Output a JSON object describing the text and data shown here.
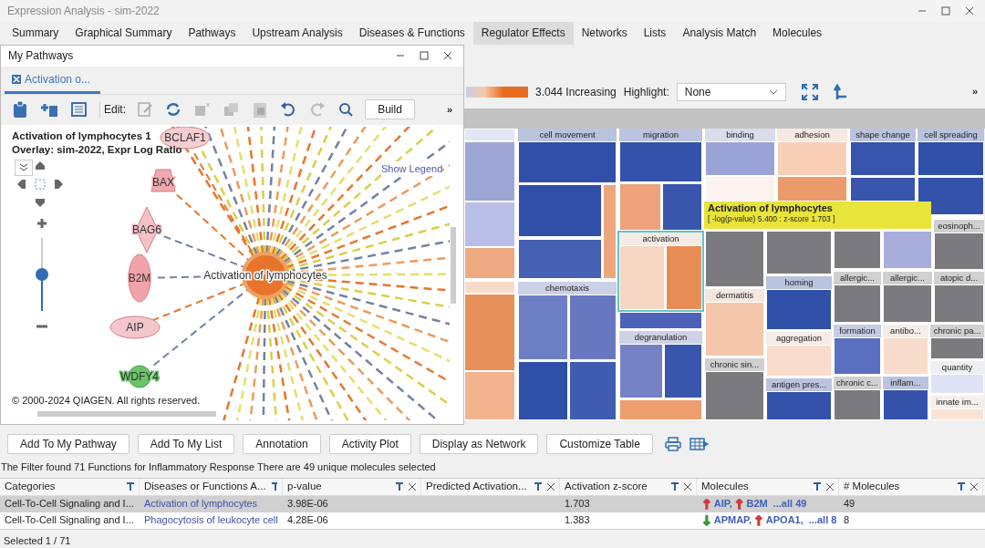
{
  "window": {
    "title": "Expression Analysis - sim-2022"
  },
  "tabs": [
    {
      "label": "Summary",
      "selected": false
    },
    {
      "label": "Graphical Summary",
      "selected": false
    },
    {
      "label": "Pathways",
      "selected": false
    },
    {
      "label": "Upstream Analysis",
      "selected": false
    },
    {
      "label": "Diseases & Functions",
      "selected": false
    },
    {
      "label": "Regulator Effects",
      "selected": true
    },
    {
      "label": "Networks",
      "selected": false
    },
    {
      "label": "Lists",
      "selected": false
    },
    {
      "label": "Analysis Match",
      "selected": false
    },
    {
      "label": "Molecules",
      "selected": false
    }
  ],
  "pathway_panel": {
    "title": "My Pathways",
    "tab": {
      "label": "Activation o...",
      "selected": true
    },
    "edit_label": "Edit:",
    "build_button": "Build",
    "overflow": "»",
    "graph": {
      "title": "Activation of lymphocytes 1",
      "overlay": "Overlay: sim-2022, Expr Log Ratio",
      "legend_link": "Show Legend",
      "center_node": "Activation of lymphocytes",
      "nodes": [
        {
          "label": "BCLAF1",
          "kind": "ellipse",
          "color": "#f4cdd0"
        },
        {
          "label": "BAX",
          "kind": "trapezoid",
          "color": "#f0a9ae"
        },
        {
          "label": "BAG6",
          "kind": "diamond",
          "color": "#f4c1c6"
        },
        {
          "label": "B2M",
          "kind": "tall-ellipse",
          "color": "#f0a4aa"
        },
        {
          "label": "AIP",
          "kind": "ellipse",
          "color": "#f4c6ca"
        },
        {
          "label": "WDFY4",
          "kind": "circle",
          "color": "#6cc46a"
        }
      ],
      "zoom_slider": {
        "level": 0.5
      },
      "copyright": "© 2000-2024 QIAGEN. All rights reserved."
    }
  },
  "treemap_toolbar": {
    "legend_value": "3.044 Increasing",
    "highlight_label": "Highlight:",
    "highlight_value": "None",
    "overflow": "»"
  },
  "treemap": {
    "tiles": [
      {
        "selected": false,
        "blocks": [
          {
            "color": "#e3e6f3"
          },
          {
            "color": "#9ea6d6"
          },
          {
            "color": "#b9bee6"
          },
          {
            "color": "#eeaa82"
          }
        ]
      },
      {
        "selected": false,
        "blocks": [
          {
            "color": "#f8dccb"
          },
          {
            "color": "#e8905a"
          },
          {
            "color": "#f3b38f"
          }
        ]
      },
      {
        "label": "cell movement",
        "selected": false,
        "blocks": [
          {
            "color": "#2f4fa8"
          },
          {
            "color": "#2f4fa8"
          },
          {
            "color": "#eda57e"
          },
          {
            "color": "#4660b4"
          }
        ]
      },
      {
        "label": "chemotaxis",
        "selected": false,
        "blocks": [
          {
            "color": "#6c7fc4"
          },
          {
            "color": "#6878c0"
          },
          {
            "color": "#2f50a8"
          },
          {
            "color": "#3f5cb0"
          }
        ]
      },
      {
        "label": "migration",
        "selected": false,
        "blocks": [
          {
            "color": "#3552aa"
          },
          {
            "color": "#eda27c"
          },
          {
            "color": "#3a56ac"
          }
        ]
      },
      {
        "label": "activation",
        "selected": true,
        "blocks": [
          {
            "color": "#f7d6c3"
          },
          {
            "color": "#e88c55"
          }
        ]
      },
      {
        "selected": false,
        "blocks": [
          {
            "color": "#4d62b8"
          }
        ]
      },
      {
        "label": "degranulation",
        "selected": false,
        "blocks": [
          {
            "color": "#7581c4"
          },
          {
            "color": "#3a56ac"
          },
          {
            "color": "#ee9d6e"
          }
        ]
      },
      {
        "label": "binding",
        "selected": false,
        "blocks": [
          {
            "color": "#9aa3d6"
          },
          {
            "color": "#fcf3ee"
          }
        ]
      },
      {
        "label": "adhesion",
        "selected": false,
        "blocks": [
          {
            "color": "#f6cfb6"
          },
          {
            "color": "#eb9b6a"
          }
        ]
      },
      {
        "label": "shape change",
        "selected": false,
        "blocks": [
          {
            "color": "#3654ac"
          },
          {
            "color": "#3a56ac"
          }
        ]
      },
      {
        "label": "cell spreading",
        "selected": false,
        "blocks": [
          {
            "color": "#2f4fa8"
          },
          {
            "color": "#3552aa"
          }
        ]
      },
      {
        "label": "eosinoph...",
        "selected": false,
        "blocks": [
          {
            "color": "#7b7b7f"
          }
        ]
      },
      {
        "selected": false,
        "blocks": [
          {
            "color": "#7b7b7f"
          }
        ]
      },
      {
        "selected": false,
        "blocks": [
          {
            "color": "#7b7b7f"
          }
        ]
      },
      {
        "selected": false,
        "blocks": [
          {
            "color": "#7b7b7f"
          }
        ]
      },
      {
        "selected": false,
        "blocks": [
          {
            "color": "#a7aedc"
          }
        ]
      },
      {
        "label": "dermatitis",
        "selected": false,
        "blocks": [
          {
            "color": "#f4c7ad"
          }
        ]
      },
      {
        "label": "chronic sin...",
        "selected": false,
        "blocks": [
          {
            "color": "#7b7b7f"
          }
        ]
      },
      {
        "label": "homing",
        "selected": false,
        "blocks": [
          {
            "color": "#2f4fa8"
          }
        ]
      },
      {
        "label": "aggregation",
        "selected": false,
        "blocks": [
          {
            "color": "#f9dccb"
          }
        ]
      },
      {
        "label": "antigen pres...",
        "selected": false,
        "blocks": [
          {
            "color": "#3552aa"
          }
        ]
      },
      {
        "label": "allergic...",
        "selected": false,
        "blocks": [
          {
            "color": "#7b7b7f"
          }
        ]
      },
      {
        "label": "allergic...",
        "selected": false,
        "blocks": [
          {
            "color": "#7b7b7f"
          }
        ]
      },
      {
        "label": "atopic d...",
        "selected": false,
        "blocks": [
          {
            "color": "#7b7b7f"
          }
        ]
      },
      {
        "label": "formation",
        "selected": false,
        "blocks": [
          {
            "color": "#5b6fc0"
          }
        ]
      },
      {
        "label": "antibo...",
        "selected": false,
        "blocks": [
          {
            "color": "#f8dccb"
          }
        ]
      },
      {
        "label": "chronic pa...",
        "selected": false,
        "blocks": [
          {
            "color": "#7b7b7f"
          }
        ]
      },
      {
        "label": "chronic c...",
        "selected": false,
        "blocks": [
          {
            "color": "#7b7b7f"
          }
        ]
      },
      {
        "label": "inflam...",
        "selected": false,
        "blocks": [
          {
            "color": "#3552aa"
          }
        ]
      },
      {
        "label": "quantity",
        "selected": false,
        "blocks": [
          {
            "color": "#dfe3f5"
          }
        ]
      },
      {
        "label": "innate im...",
        "selected": false,
        "blocks": [
          {
            "color": "#fbe4d6"
          }
        ]
      }
    ],
    "tooltip": {
      "title": "Activation of lymphocytes",
      "detail": "[ -log(p-value) 5.400 : z-score 1.703 ]"
    }
  },
  "actions": [
    "Add To My Pathway",
    "Add To My List",
    "Annotation",
    "Activity Plot",
    "Display as Network",
    "Customize Table"
  ],
  "filter_text": "The Filter found 71 Functions for Inflammatory Response There are 49 unique molecules selected",
  "table": {
    "columns": [
      {
        "label": "Categories",
        "filter": true,
        "close": false
      },
      {
        "label": "Diseases or Functions A...",
        "filter": true,
        "close": false
      },
      {
        "label": "p-value",
        "filter": true,
        "close": true
      },
      {
        "label": "Predicted Activation...",
        "filter": true,
        "close": true
      },
      {
        "label": "Activation z-score",
        "filter": true,
        "close": true
      },
      {
        "label": "Molecules",
        "filter": true,
        "close": true
      },
      {
        "label": "# Molecules",
        "filter": true,
        "close": true
      }
    ],
    "rows": [
      {
        "selected": true,
        "category": "Cell-To-Cell Signaling and I...",
        "function": "Activation of lymphocytes",
        "p_value": "3.98E-06",
        "z_score": "1.703",
        "molecules": [
          {
            "arrow": "↑",
            "color": "#d23a3a",
            "name": "AIP,"
          },
          {
            "arrow": "↑",
            "color": "#d23a3a",
            "name": "B2M"
          }
        ],
        "molecules_more": "...all 49",
        "count": "49"
      },
      {
        "selected": false,
        "category": "Cell-To-Cell Signaling and I...",
        "function": "Phagocytosis of leukocyte cell",
        "p_value": "4.28E-06",
        "z_score": "1.383",
        "molecules": [
          {
            "arrow": "↓",
            "color": "#3a9a3a",
            "name": "APMAP,"
          },
          {
            "arrow": "↑",
            "color": "#d23a3a",
            "name": "APOA1,"
          }
        ],
        "molecules_more": "...all 8",
        "count": "8"
      }
    ]
  },
  "status_bar": "Selected 1 / 71"
}
